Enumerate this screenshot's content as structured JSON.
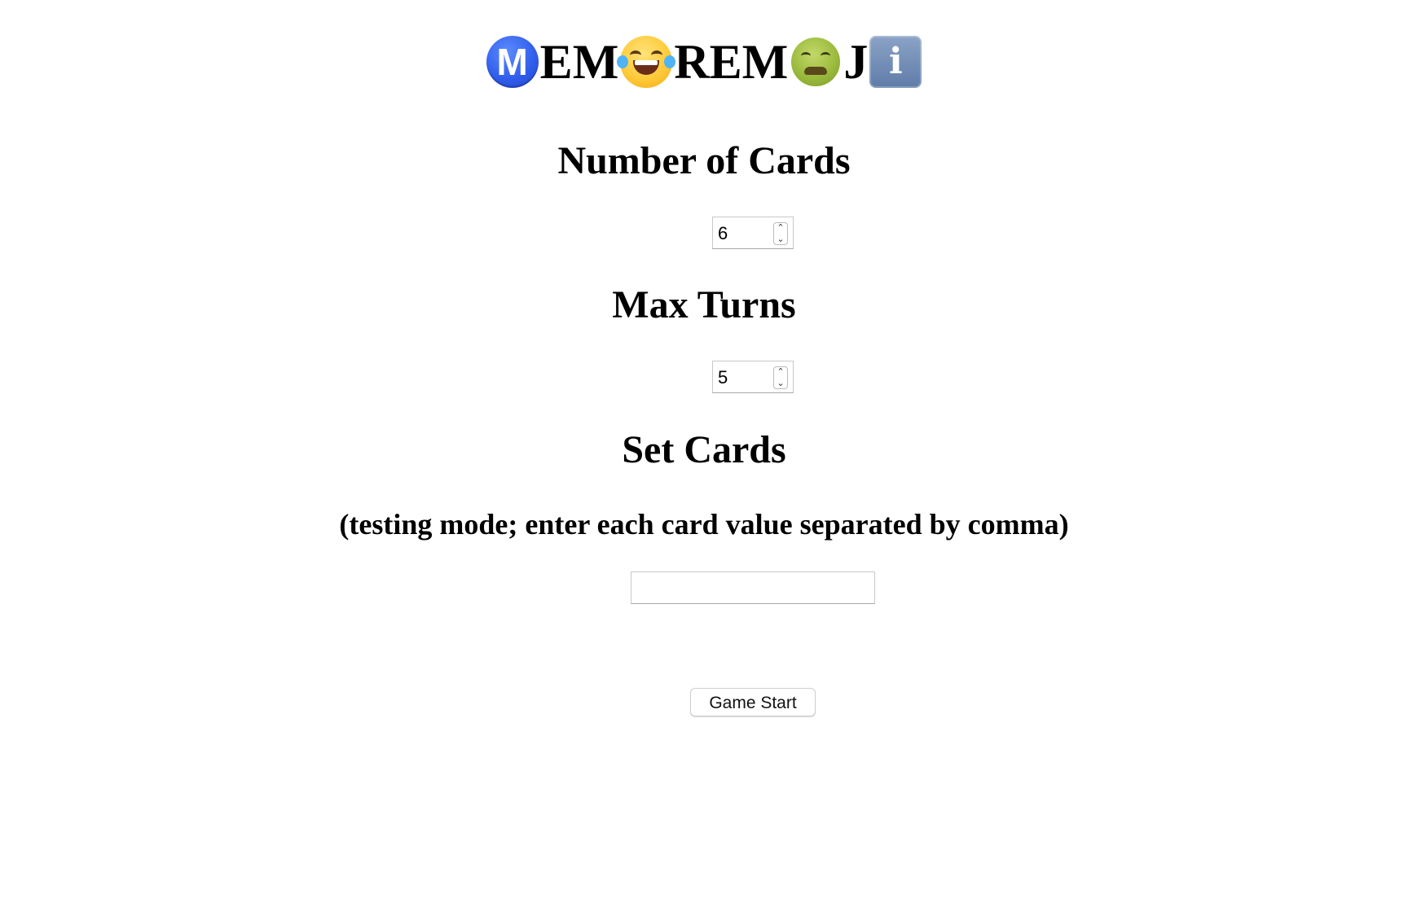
{
  "title": {
    "segment_1": "EM",
    "segment_2": "REM",
    "segment_3": "J",
    "m_icon_letter": "M",
    "info_icon_letter": "i",
    "icons": [
      "m-circle-icon",
      "laughing-crying-face-icon",
      "nauseated-face-icon",
      "info-icon"
    ]
  },
  "sections": {
    "num_cards_heading": "Number of Cards",
    "num_cards_value": "6",
    "max_turns_heading": "Max Turns",
    "max_turns_value": "5",
    "set_cards_heading": "Set Cards",
    "set_cards_subheading": "(testing mode; enter each card value separated by comma)",
    "set_cards_value": ""
  },
  "actions": {
    "start_label": "Game Start"
  },
  "colors": {
    "m_icon": "#2f5bea",
    "laugh_face": "#ffcb3a",
    "sick_face": "#9bbb3d",
    "info_icon": "#6f8bb5"
  }
}
